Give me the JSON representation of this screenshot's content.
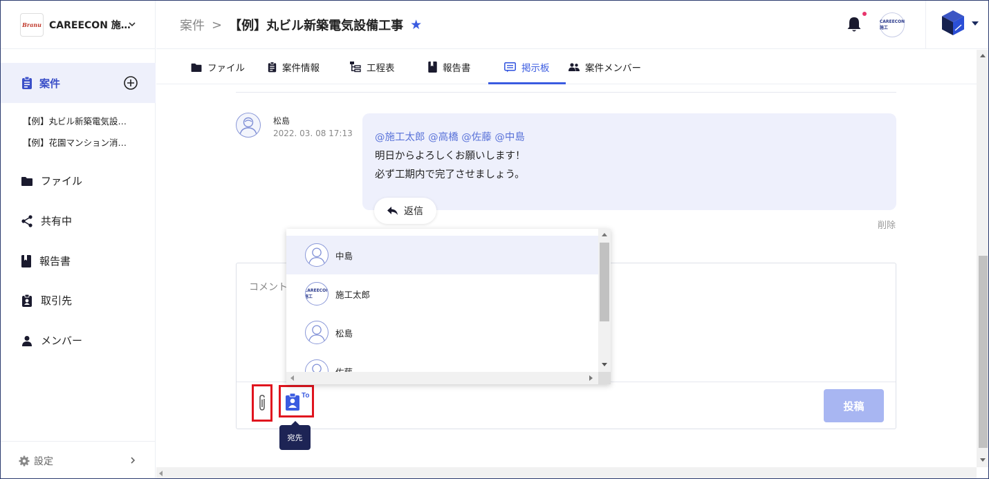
{
  "org": {
    "logo_text": "Branu",
    "name": "CAREECON 施…"
  },
  "sidebar": {
    "active": {
      "label": "案件"
    },
    "projects": [
      "【例】丸ビル新築電気設…",
      "【例】花園マンション消…"
    ],
    "items": [
      {
        "label": "ファイル",
        "icon": "folder-icon"
      },
      {
        "label": "共有中",
        "icon": "share-icon"
      },
      {
        "label": "報告書",
        "icon": "book-icon"
      },
      {
        "label": "取引先",
        "icon": "contact-badge-icon"
      },
      {
        "label": "メンバー",
        "icon": "person-icon"
      }
    ],
    "settings": {
      "label": "設定"
    }
  },
  "header": {
    "crumb_root": "案件",
    "crumb_sep": ">",
    "title": "【例】丸ビル新築電気設備工事",
    "star": "★",
    "avatar_text": "CAREECON施工"
  },
  "tabs": [
    {
      "label": "ファイル"
    },
    {
      "label": "案件情報"
    },
    {
      "label": "工程表"
    },
    {
      "label": "報告書"
    },
    {
      "label": "掲示板",
      "active": true
    },
    {
      "label": "案件メンバー"
    }
  ],
  "message": {
    "author": "松島",
    "time": "2022. 03. 08 17:13",
    "mentions": "@施工太郎 @高橋 @佐藤 @中島",
    "line1": "明日からよろしくお願いします！",
    "line2": "必ず工期内で完了させましょう。",
    "reply_label": "返信",
    "delete_label": "削除"
  },
  "comment": {
    "placeholder": "コメント",
    "post_label": "投稿",
    "to_label": "To",
    "tooltip": "宛先"
  },
  "dropdown": {
    "items": [
      {
        "label": "中島",
        "selected": true,
        "avatar": "person"
      },
      {
        "label": "施工太郎",
        "selected": false,
        "avatar": "logo",
        "logo_text": "CAREECON施工"
      },
      {
        "label": "松島",
        "selected": false,
        "avatar": "person"
      },
      {
        "label": "佐藤",
        "selected": false,
        "avatar": "person"
      }
    ]
  },
  "colors": {
    "accent": "#3a5be0",
    "highlight_box": "#e0141e",
    "tooltip_bg": "#1d2455",
    "post_button": "#a8b6f2"
  }
}
